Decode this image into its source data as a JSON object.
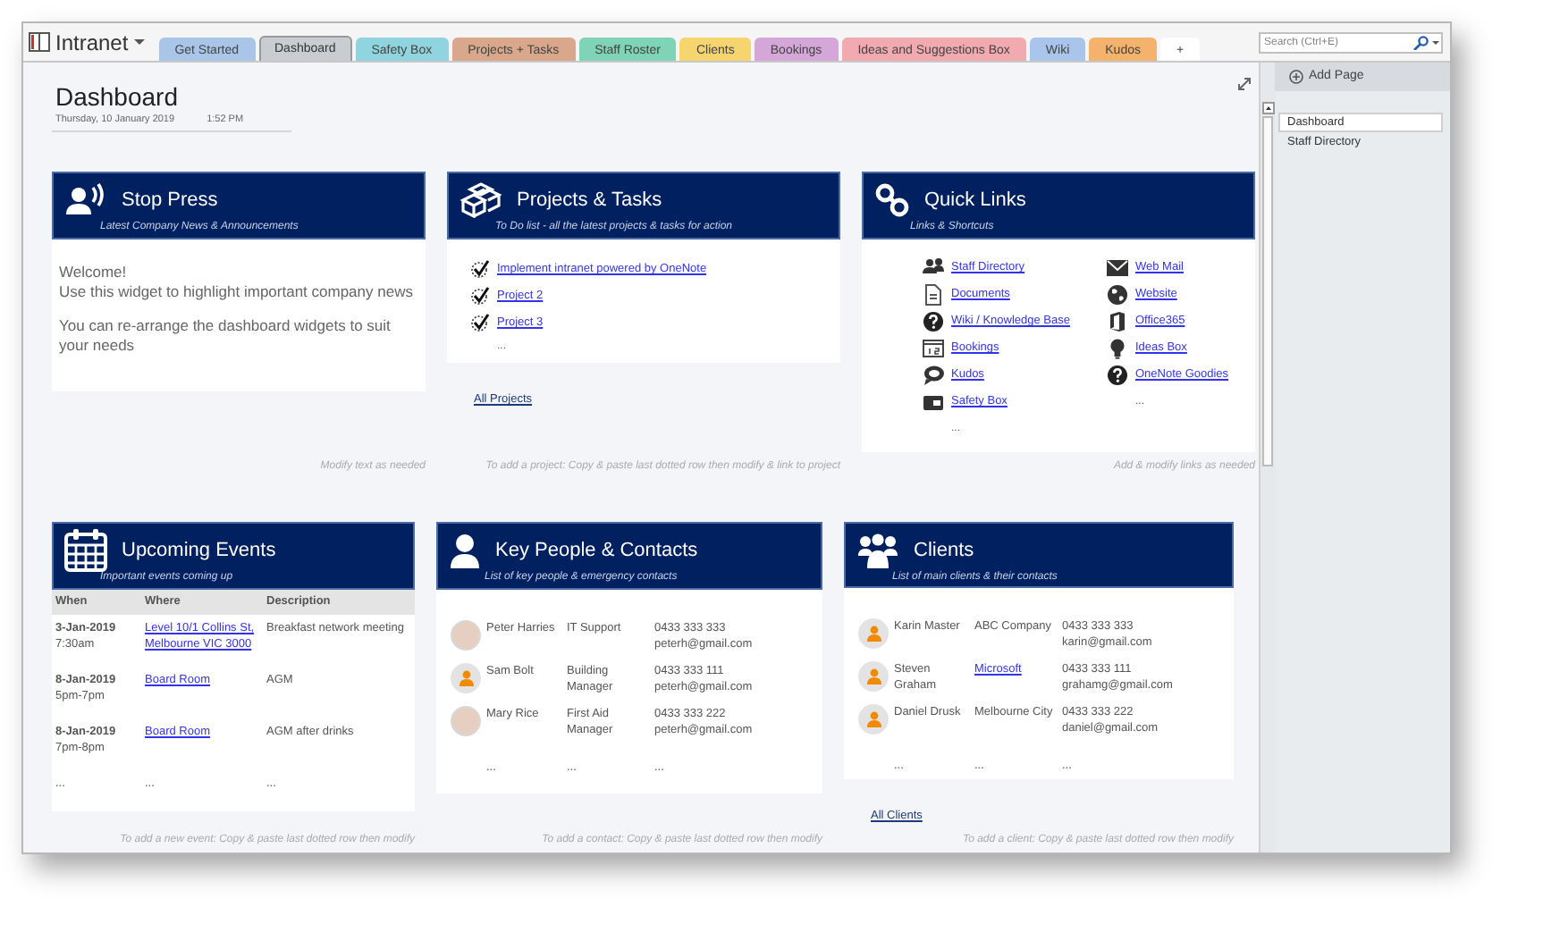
{
  "app": {
    "title": "Intranet",
    "search": {
      "placeholder": "Search (Ctrl+E)"
    }
  },
  "tabs": [
    {
      "label": "Get Started",
      "color": "#a9c6e8",
      "selected": false
    },
    {
      "label": "Dashboard",
      "color": "#c9ccd0",
      "selected": true
    },
    {
      "label": "Safety Box",
      "color": "#8fd4de",
      "selected": false
    },
    {
      "label": "Projects + Tasks",
      "color": "#d9a88c",
      "selected": false
    },
    {
      "label": "Staff Roster",
      "color": "#7fd3b6",
      "selected": false
    },
    {
      "label": "Clients",
      "color": "#f6d46e",
      "selected": false
    },
    {
      "label": "Bookings",
      "color": "#d5a7d9",
      "selected": false
    },
    {
      "label": "Ideas and Suggestions Box",
      "color": "#f1aab0",
      "selected": false
    },
    {
      "label": "Wiki",
      "color": "#a9c5ec",
      "selected": false
    },
    {
      "label": "Kudos",
      "color": "#f4b36c",
      "selected": false
    },
    {
      "label": "+",
      "color": "#ffffff",
      "selected": false
    }
  ],
  "page": {
    "title": "Dashboard",
    "date": "Thursday, 10 January 2019",
    "time": "1:52 PM"
  },
  "widgets": [
    {
      "kind": "news",
      "title": "Stop Press",
      "subtitle": "Latest Company News & Announcements",
      "paragraphs": [
        [
          "Welcome!",
          "Use this widget to highlight important company news"
        ],
        [
          "You can re-arrange the dashboard widgets to suit your needs"
        ]
      ],
      "note": "Modify text as needed"
    },
    {
      "kind": "tasks",
      "title": "Projects & Tasks",
      "subtitle": "To Do list - all the latest projects & tasks for action",
      "items": [
        {
          "label": "Implement intranet powered by OneNote",
          "checked": true
        },
        {
          "label": "Project 2",
          "checked": true
        },
        {
          "label": "Project 3",
          "checked": true
        }
      ],
      "more": "...",
      "link": "All Projects",
      "note": "To add a project: Copy & paste last dotted row then modify & link to project"
    },
    {
      "kind": "links",
      "title": "Quick Links",
      "subtitle": "Links & Shortcuts",
      "columns": [
        {
          "items": [
            "Staff Directory",
            "Documents",
            "Wiki / Knowledge Base",
            "Bookings",
            "Kudos",
            "Safety Box"
          ],
          "more": "..."
        },
        {
          "items": [
            "Web Mail",
            "Website",
            "Office365",
            "Ideas Box",
            "OneNote Goodies"
          ],
          "more": "..."
        }
      ],
      "note": "Add & modify links as needed"
    },
    {
      "kind": "events",
      "title": "Upcoming Events",
      "subtitle": "Important events coming up",
      "columns": [
        "When",
        "Where",
        "Description"
      ],
      "rows": [
        {
          "date": "3-Jan-2019",
          "time": "7:30am",
          "where": "Level 10/1 Collins St, Melbourne VIC 3000",
          "description": "Breakfast network meeting"
        },
        {
          "date": "8-Jan-2019",
          "time": "5pm-7pm",
          "where": "Board Room",
          "description": "AGM"
        },
        {
          "date": "8-Jan-2019",
          "time": "7pm-8pm",
          "where": "Board Room",
          "description": "AGM after drinks"
        }
      ],
      "more": [
        "...",
        "...",
        "..."
      ],
      "note": "To add a new event: Copy & paste last dotted row then modify"
    },
    {
      "kind": "contacts",
      "title": "Key People & Contacts",
      "subtitle": "List of key people & emergency contacts",
      "rows": [
        {
          "kind": "photo",
          "name": "Peter Harries",
          "role": "IT Support",
          "role_link": false,
          "phone": "0433 333 333",
          "email": "peterh@gmail.com"
        },
        {
          "kind": "generic",
          "name": "Sam Bolt",
          "role": "Building Manager",
          "role_link": false,
          "phone": "0433 333 111",
          "email": "peterh@gmail.com"
        },
        {
          "kind": "photo",
          "name": "Mary Rice",
          "role": "First Aid Manager",
          "role_link": false,
          "phone": "0433 333 222",
          "email": "peterh@gmail.com"
        }
      ],
      "more": [
        "...",
        "...",
        "..."
      ],
      "note": "To add a contact: Copy & paste last dotted row then modify"
    },
    {
      "kind": "contacts",
      "title": "Clients",
      "subtitle": "List of main clients & their contacts",
      "rows": [
        {
          "kind": "generic",
          "name": "Karin Master",
          "role": "ABC Company",
          "role_link": false,
          "phone": "0433 333 333",
          "email": "karin@gmail.com"
        },
        {
          "kind": "generic",
          "name": "Steven Graham",
          "role": "Microsoft",
          "role_link": true,
          "phone": "0433 333 111",
          "email": "grahamg@gmail.com"
        },
        {
          "kind": "generic",
          "name": "Daniel Drusk",
          "role": "Melbourne City",
          "role_link": false,
          "phone": "0433 333 222",
          "email": "daniel@gmail.com"
        }
      ],
      "more": [
        "...",
        "...",
        "..."
      ],
      "link": "All Clients",
      "note": "To add a client: Copy & paste last dotted row then modify"
    }
  ],
  "sidebar": {
    "add_page": "Add Page",
    "pages": [
      {
        "label": "Dashboard",
        "selected": true
      },
      {
        "label": "Staff Directory",
        "selected": false
      }
    ]
  }
}
